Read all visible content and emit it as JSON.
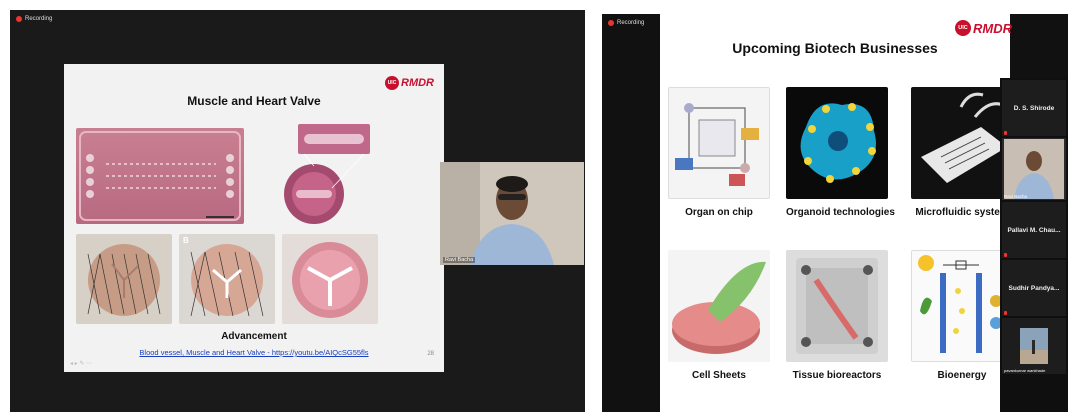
{
  "left": {
    "recording_label": "Recording",
    "slide": {
      "logo_badge": "UIC",
      "logo_text": "RMDR",
      "title": "Muscle and Heart Valve",
      "panel_label": "B",
      "subtitle": "Advancement",
      "link": "Blood vessel, Muscle and Heart Valve - https://youtu.be/AIQcSG55fls",
      "page_number": "28"
    },
    "webcam": {
      "name": "Ravi Bacha"
    }
  },
  "right": {
    "recording_label": "Recording",
    "slide": {
      "logo_badge": "UIC",
      "logo_text": "RMDR",
      "title": "Upcoming Biotech Businesses",
      "tiles": [
        {
          "label": "Organ on chip"
        },
        {
          "label": "Organoid technologies"
        },
        {
          "label": "Microfluidic system"
        },
        {
          "label": "Cell Sheets"
        },
        {
          "label": "Tissue bioreactors"
        },
        {
          "label": "Bioenergy"
        }
      ]
    },
    "participants": [
      {
        "name": "D. S. Shirode"
      },
      {
        "name": "Ravi Bacha",
        "video": true
      },
      {
        "name": "Pallavi M. Chau..."
      },
      {
        "name": "Sudhir Pandya..."
      },
      {
        "name": "pavankumar wankhade",
        "video": true
      }
    ],
    "colors": {
      "accent": "#c8102e",
      "link": "#1a3fbf"
    }
  }
}
